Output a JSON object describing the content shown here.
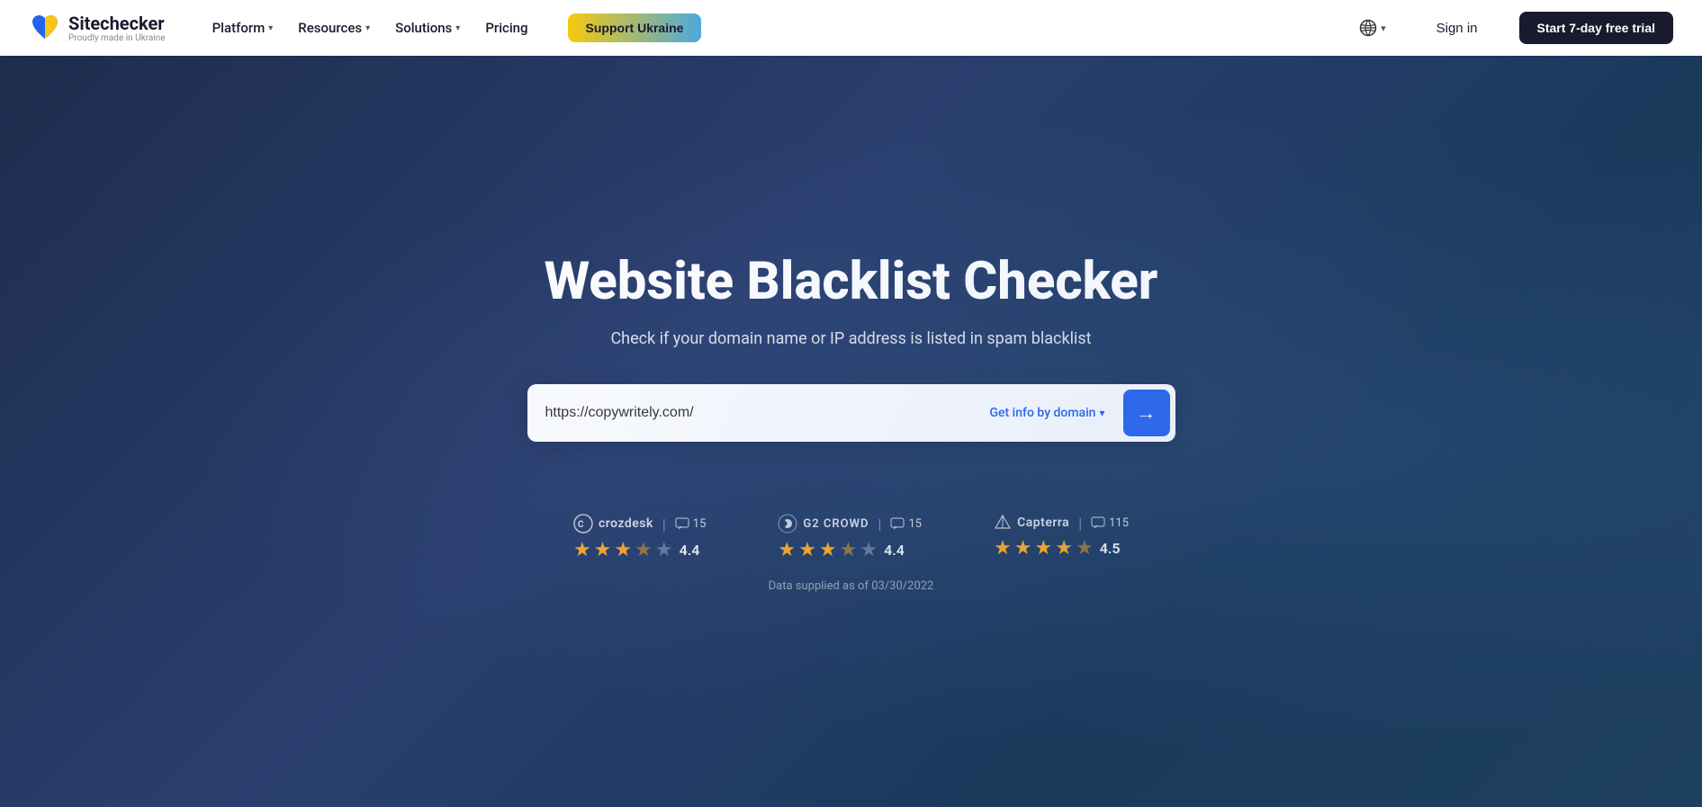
{
  "navbar": {
    "logo_name": "Sitechecker",
    "logo_tagline": "Proudly made in Ukraine",
    "nav_items": [
      {
        "label": "Platform",
        "has_dropdown": true
      },
      {
        "label": "Resources",
        "has_dropdown": true
      },
      {
        "label": "Solutions",
        "has_dropdown": true
      },
      {
        "label": "Pricing",
        "has_dropdown": false
      }
    ],
    "support_label": "Support Ukraine",
    "globe_label": "",
    "signin_label": "Sign in",
    "trial_label": "Start 7-day free trial"
  },
  "hero": {
    "title": "Website Blacklist Checker",
    "subtitle": "Check if your domain name or IP address is listed in spam blacklist",
    "search_value": "https://copywritely.com/",
    "search_placeholder": "https://copywritely.com/",
    "get_info_label": "Get info by domain",
    "chevron": "›"
  },
  "reviews": [
    {
      "name": "crozdesk",
      "count": "15",
      "stars": [
        1,
        1,
        1,
        0.5,
        0
      ],
      "score": "4.4"
    },
    {
      "name": "G2 CROWD",
      "count": "15",
      "stars": [
        1,
        1,
        1,
        0.5,
        0
      ],
      "score": "4.4"
    },
    {
      "name": "Capterra",
      "count": "115",
      "stars": [
        1,
        1,
        1,
        1,
        0.5
      ],
      "score": "4.5"
    }
  ],
  "data_supplied": "Data supplied as of 03/30/2022"
}
